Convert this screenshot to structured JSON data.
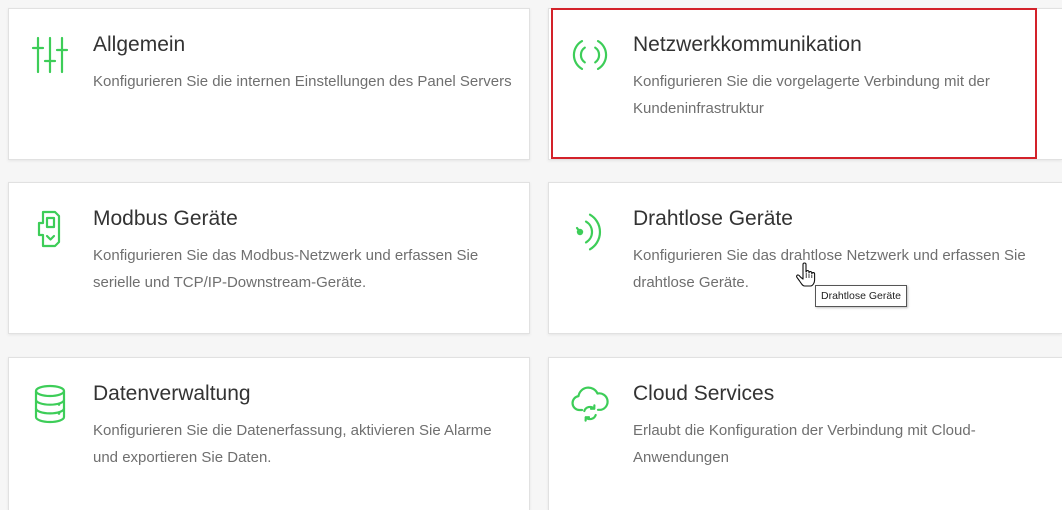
{
  "theme": {
    "accent": "#3dcd58",
    "highlight": "#d3222a",
    "title_color": "#333333",
    "text_color": "#6f6f6f"
  },
  "cards": [
    {
      "title": "Allgemein",
      "icon": "sliders-icon",
      "description_lines": [
        "Konfigurieren Sie die internen Einstellungen des Panel Servers"
      ]
    },
    {
      "title": "Netzwerkkommunikation",
      "icon": "broadcast-icon",
      "highlighted": true,
      "description_lines": [
        "Konfigurieren Sie die vorgelagerte Verbindung mit der",
        "Kundeninfrastruktur"
      ]
    },
    {
      "title": "Modbus Geräte",
      "icon": "modbus-device-icon",
      "description_lines": [
        "Konfigurieren Sie das Modbus-Netzwerk und erfassen Sie",
        "serielle und TCP/IP-Downstream-Geräte."
      ]
    },
    {
      "title": "Drahtlose Geräte",
      "icon": "wireless-icon",
      "description_lines": [
        "Konfigurieren Sie das drahtlose Netzwerk und erfassen Sie",
        "drahtlose Geräte."
      ]
    },
    {
      "title": "Datenverwaltung",
      "icon": "database-icon",
      "description_lines": [
        "Konfigurieren Sie die Datenerfassung, aktivieren Sie Alarme",
        "und exportieren Sie Daten."
      ]
    },
    {
      "title": "Cloud Services",
      "icon": "cloud-sync-icon",
      "description_lines": [
        "Erlaubt die Konfiguration der Verbindung mit Cloud-",
        "Anwendungen"
      ]
    }
  ],
  "tooltip": {
    "text": "Drahtlose Geräte"
  },
  "cursor": {
    "icon": "hand-pointer-icon"
  }
}
